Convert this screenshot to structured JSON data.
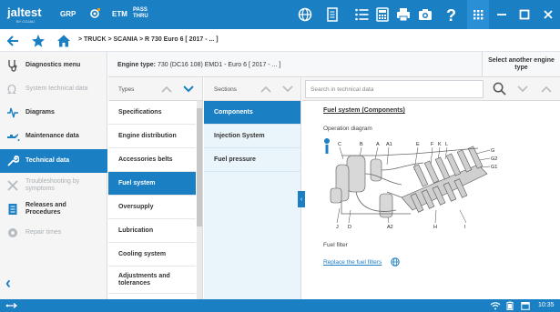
{
  "topbar": {
    "logo": "jaltest",
    "logo_sub": "BY COJALI",
    "grp_label": "GRP",
    "etm_label": "ETM",
    "pass_label_1": "PASS",
    "pass_label_2": "THRU",
    "accent": "#1b7fc4"
  },
  "breadcrumb": {
    "path": "> TRUCK  >  SCANIA  >  R 730 Euro 6 [ 2017 - ... ]"
  },
  "sidebar": {
    "items": [
      {
        "label": "Diagnostics menu",
        "icon": "stethoscope-icon",
        "state": "normal"
      },
      {
        "label": "System technical data",
        "icon": "omega-icon",
        "state": "disabled"
      },
      {
        "label": "Diagrams",
        "icon": "waveform-icon",
        "state": "normal"
      },
      {
        "label": "Maintenance data",
        "icon": "oil-can-icon",
        "state": "normal"
      },
      {
        "label": "Technical data",
        "icon": "wrench-icon",
        "state": "active"
      },
      {
        "label": "Troubleshooting by symptoms",
        "icon": "tools-icon",
        "state": "disabled"
      },
      {
        "label": "Releases and Procedures",
        "icon": "document-icon",
        "state": "normal"
      },
      {
        "label": "Repair times",
        "icon": "gear-clock-icon",
        "state": "disabled"
      }
    ]
  },
  "engine": {
    "label": "Engine type:",
    "value": "730 (DC16 108) EMD1 - Euro 6 [ 2017 - ... ]",
    "select_label": "Select another engine type"
  },
  "types": {
    "header": "Types",
    "items": [
      "Specifications",
      "Engine distribution",
      "Accessories belts",
      "Fuel system",
      "Oversupply",
      "Lubrication",
      "Cooling system",
      "Adjustments and tolerances"
    ],
    "active_index": 3
  },
  "sections": {
    "header": "Sections",
    "items": [
      "Components",
      "Injection System",
      "Fuel pressure"
    ],
    "active_index": 0
  },
  "search": {
    "placeholder": "Search in technical data"
  },
  "content": {
    "title": "Fuel system (Components)",
    "subtitle": "Operation diagram",
    "caption": "Fuel filter",
    "link": "Replace the fuel filters",
    "diagram_labels_top": [
      "C",
      "B",
      "A",
      "A1",
      "E",
      "F",
      "K",
      "L"
    ],
    "diagram_labels_right": [
      "G",
      "G2",
      "G1"
    ],
    "diagram_labels_bottom": [
      "J",
      "D",
      "A2",
      "H",
      "I"
    ]
  },
  "status": {
    "time": "10:35"
  }
}
